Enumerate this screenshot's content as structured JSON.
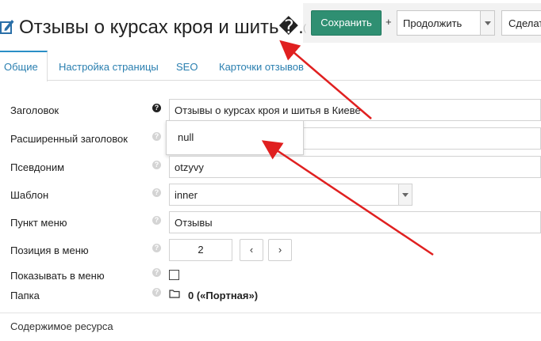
{
  "header": {
    "title": "Отзывы о курсах кроя и шить�...",
    "title_suffix": "(",
    "icon": "edit-pencil-icon",
    "save_label": "Сохранить",
    "plus": "+",
    "continue_select": "Продолжить",
    "action_select": "Сделат"
  },
  "tabs": [
    {
      "label": "Общие",
      "active": true
    },
    {
      "label": "Настройка страницы",
      "active": false
    },
    {
      "label": "SEO",
      "active": false
    },
    {
      "label": "Карточки отзывов",
      "active": false
    }
  ],
  "form": {
    "title": {
      "label": "Заголовок",
      "value": "Отзывы о курсах кроя и шитья в Киеве"
    },
    "longtitle": {
      "label": "Расширенный заголовок",
      "value": "",
      "autocomplete": "null"
    },
    "alias": {
      "label": "Псевдоним",
      "value": "otzyvy"
    },
    "template": {
      "label": "Шаблон",
      "value": "inner"
    },
    "menutitle": {
      "label": "Пункт меню",
      "value": "Отзывы"
    },
    "menuindex": {
      "label": "Позиция в меню",
      "value": "2",
      "prev": "‹",
      "next": "›"
    },
    "hidemenu": {
      "label": "Показывать в меню",
      "checked": false
    },
    "parent": {
      "label": "Папка",
      "value": "0 («Портная»)"
    }
  },
  "content_label": "Содержимое ресурса",
  "help_glyph": "?",
  "colors": {
    "save_button": "#2f8f72",
    "tab_link": "#2a7fb0",
    "annotation_arrow": "#e02020"
  }
}
